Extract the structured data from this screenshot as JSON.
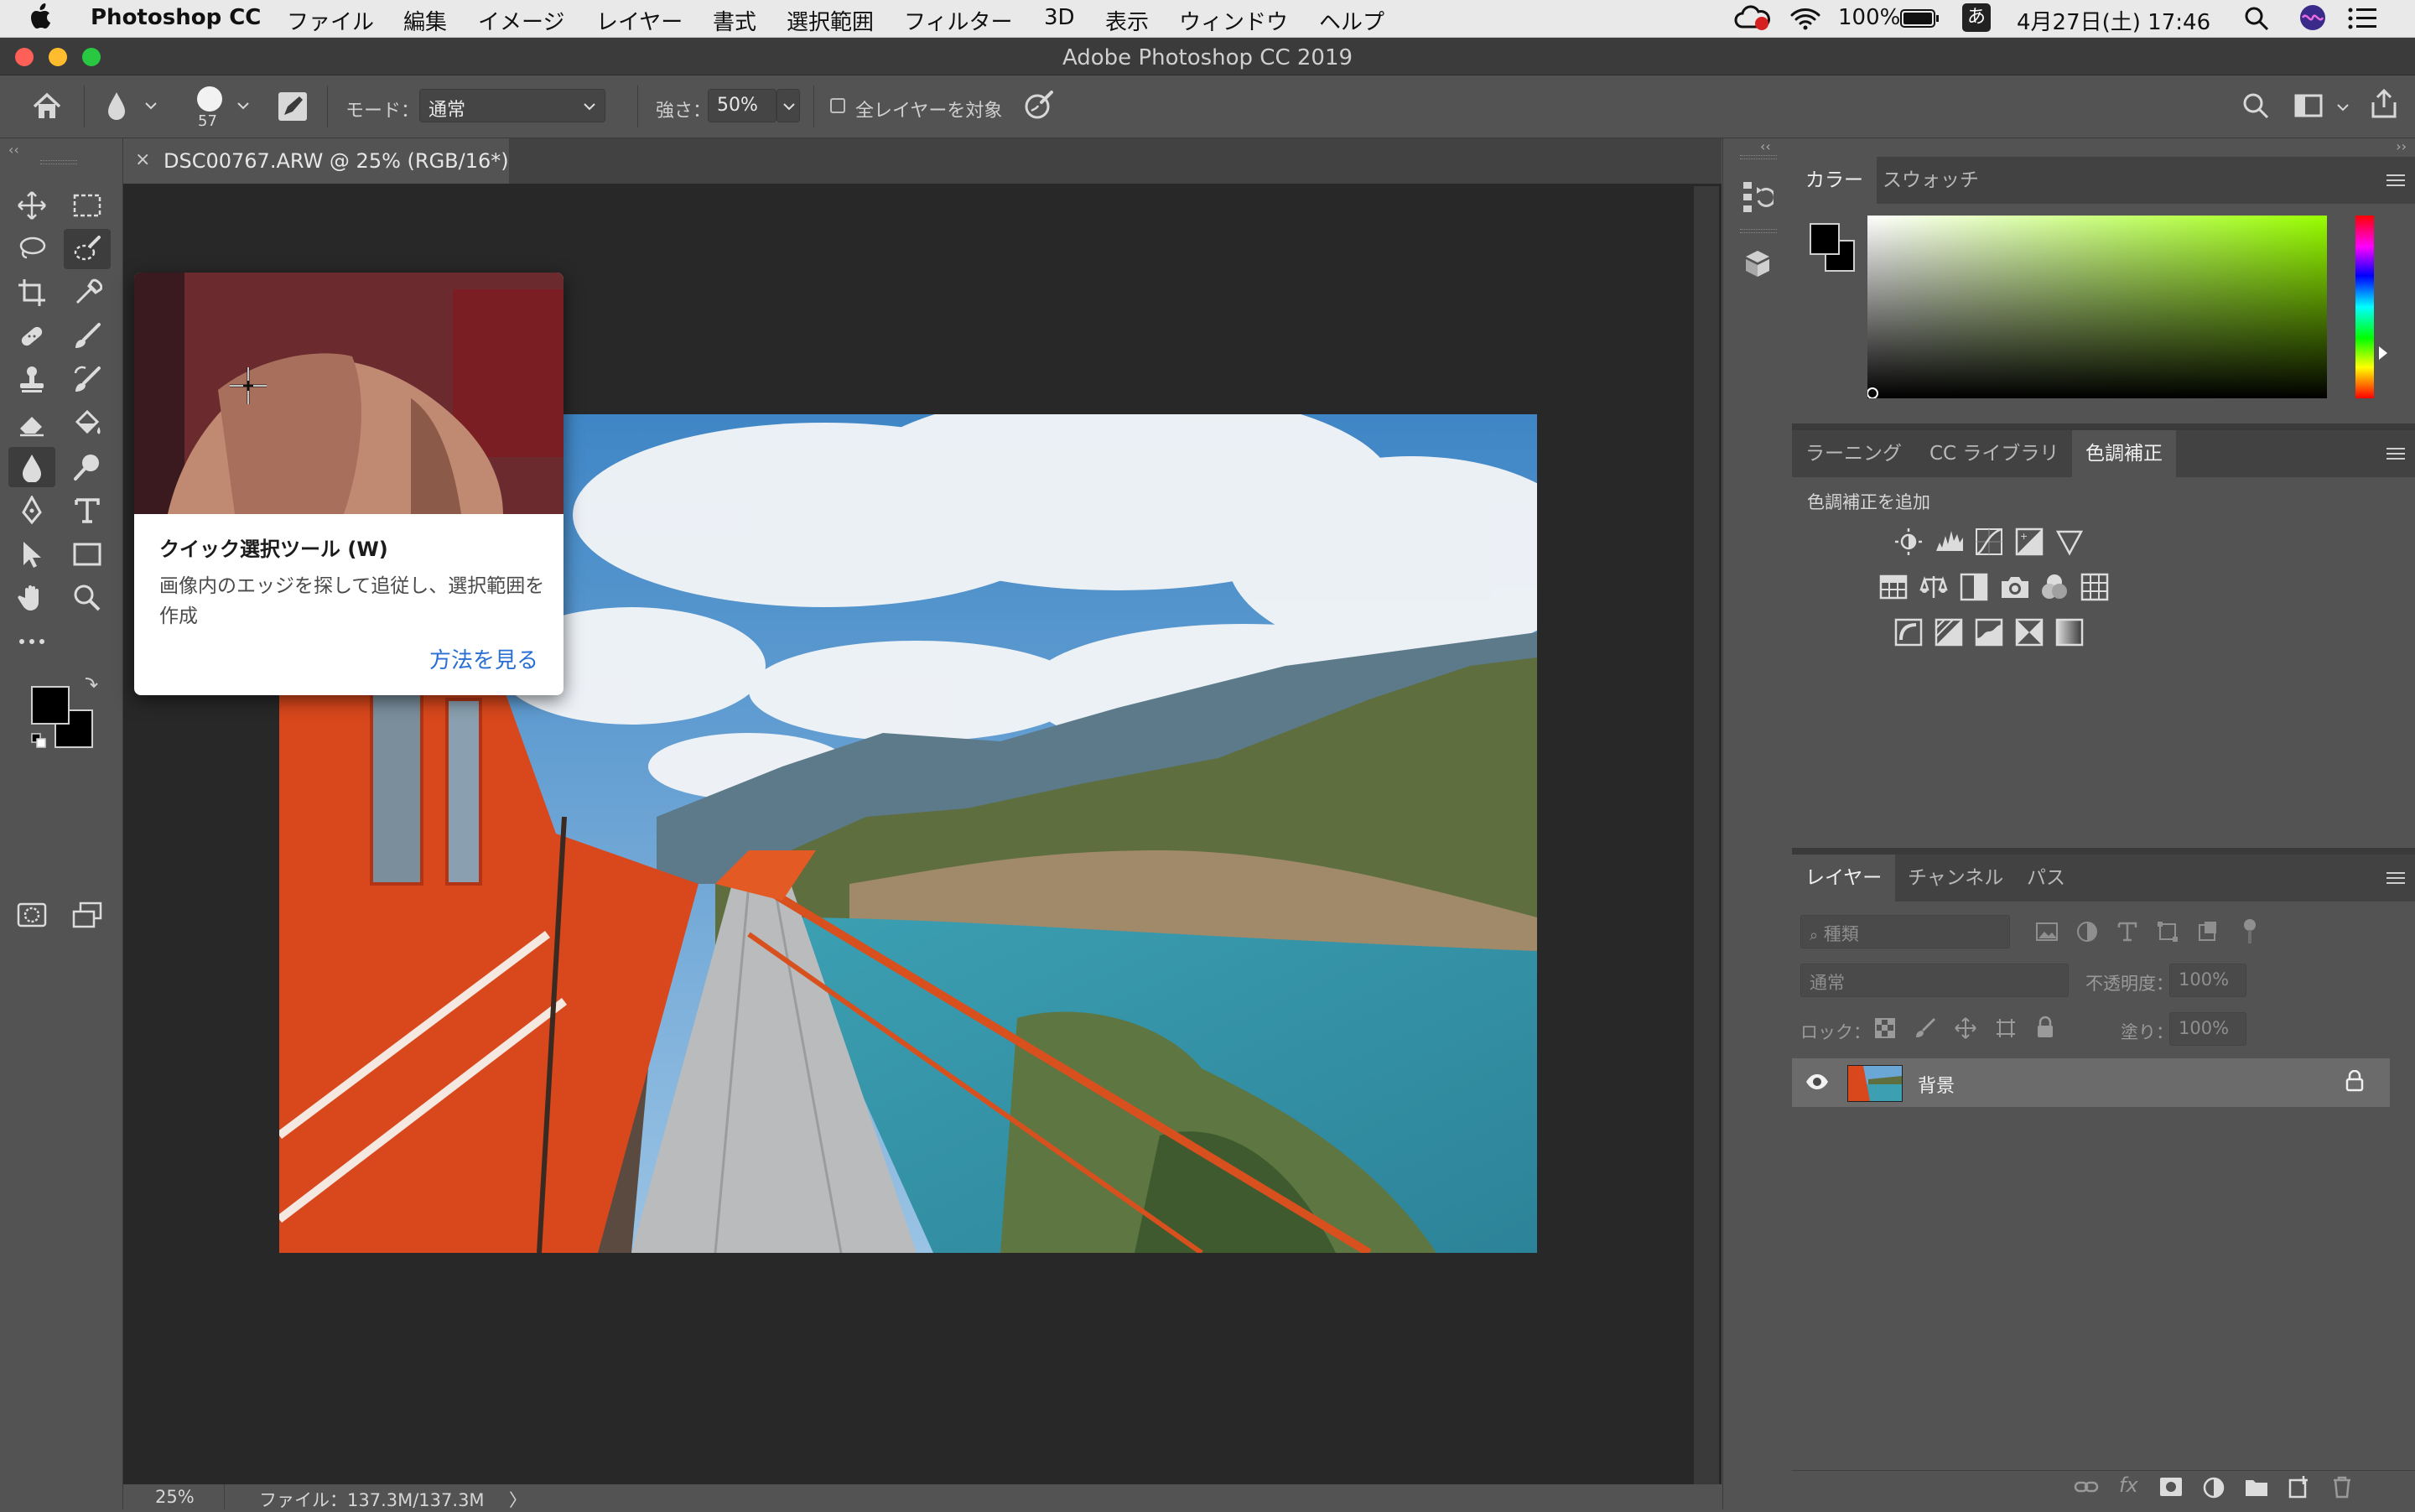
{
  "menubar": {
    "app_name": "Photoshop CC",
    "items": [
      "ファイル",
      "編集",
      "イメージ",
      "レイヤー",
      "書式",
      "選択範囲",
      "フィルター",
      "3D",
      "表示",
      "ウィンドウ",
      "ヘルプ"
    ],
    "battery": "100%",
    "input_method": "あ",
    "datetime": "4月27日(土) 17:46"
  },
  "window": {
    "title": "Adobe Photoshop CC 2019"
  },
  "options": {
    "brush_size": "57",
    "mode_label": "モード：",
    "mode_value": "通常",
    "strength_label": "強さ：",
    "strength_value": "50%",
    "all_layers_label": "全レイヤーを対象"
  },
  "document": {
    "tab_title": "DSC00767.ARW @ 25% (RGB/16*)",
    "close_glyph": "×"
  },
  "status": {
    "zoom": "25%",
    "file_info": "ファイル：137.3M/137.3M",
    "arrow": "〉"
  },
  "tooltip": {
    "title": "クイック選択ツール (W)",
    "description": "画像内のエッジを探して追従し、選択範囲を作成",
    "link": "方法を見る"
  },
  "color_panel": {
    "tabs": [
      "カラー",
      "スウォッチ"
    ],
    "active_tab": 0
  },
  "adjust_panel": {
    "tabs": [
      "ラーニング",
      "CC ライブラリ",
      "色調補正"
    ],
    "active_tab": 2,
    "heading": "色調補正を追加"
  },
  "layers_panel": {
    "tabs": [
      "レイヤー",
      "チャンネル",
      "パス"
    ],
    "active_tab": 0,
    "filter_placeholder": "種類",
    "blend_mode": "通常",
    "opacity_label": "不透明度：",
    "opacity_value": "100%",
    "lock_label": "ロック：",
    "fill_label": "塗り：",
    "fill_value": "100%",
    "layers": [
      {
        "name": "背景",
        "visible": true,
        "locked": true
      }
    ]
  },
  "colors": {
    "accent_link": "#2a6fd4",
    "foreground": "#000000",
    "background": "#000000",
    "picker_hue": "#99ff00"
  },
  "icons": {
    "menubar": [
      "apple-icon",
      "creative-cloud-icon",
      "wifi-icon",
      "battery-icon",
      "search-icon",
      "siri-icon",
      "notification-center-icon"
    ],
    "tools": [
      "move-icon",
      "marquee-icon",
      "lasso-icon",
      "quick-selection-icon",
      "crop-icon",
      "eyedropper-icon",
      "healing-brush-icon",
      "brush-icon",
      "clone-stamp-icon",
      "history-brush-icon",
      "eraser-icon",
      "paint-bucket-icon",
      "blur-icon",
      "dodge-icon",
      "pen-icon",
      "type-icon",
      "path-selection-icon",
      "rectangle-icon",
      "hand-icon",
      "zoom-icon",
      "more-tools-icon",
      "quick-mask-icon",
      "screen-mode-icon"
    ]
  }
}
